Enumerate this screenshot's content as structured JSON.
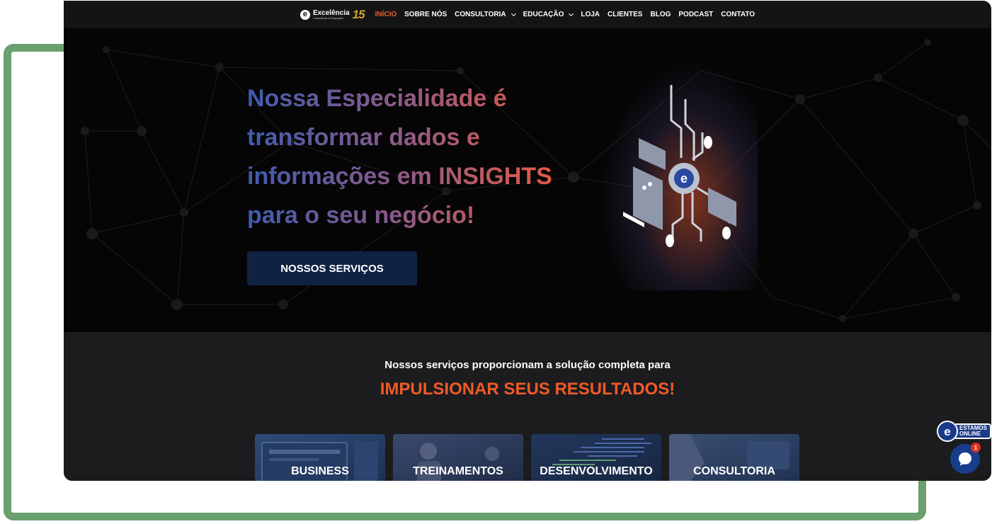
{
  "nav": {
    "logo_name": "Excelência",
    "logo_sub": "Consultoria & Educação",
    "logo_anniversary": "15",
    "items": [
      {
        "label": "INÍCIO",
        "active": true
      },
      {
        "label": "SOBRE NÓS"
      },
      {
        "label": "CONSULTORIA",
        "dropdown": true
      },
      {
        "label": "EDUCAÇÃO",
        "dropdown": true
      },
      {
        "label": "LOJA"
      },
      {
        "label": "CLIENTES"
      },
      {
        "label": "BLOG"
      },
      {
        "label": "PODCAST"
      },
      {
        "label": "CONTATO"
      }
    ]
  },
  "hero": {
    "title_lines": [
      "Nossa Especialidade é",
      "transformar dados e",
      "informações em INSIGHTS",
      "para o seu negócio!"
    ],
    "button_label": "NOSSOS SERVIÇOS"
  },
  "services": {
    "intro": "Nossos serviços proporcionam a solução completa para",
    "headline": "IMPULSIONAR SEUS RESULTADOS!",
    "cards": [
      {
        "label": "BUSINESS"
      },
      {
        "label": "TREINAMENTOS"
      },
      {
        "label": "DESENVOLVIMENTO"
      },
      {
        "label": "CONSULTORIA"
      }
    ]
  },
  "chat": {
    "badge_line1": "ESTAMOS",
    "badge_line2": "ONLINE",
    "unread_count": "1",
    "icon": "chat-bubble-icon"
  },
  "colors": {
    "accent": "#f05a28",
    "button_bg": "#0f2244",
    "frame_green": "#6aa06f",
    "chat_blue": "#183d8a"
  }
}
